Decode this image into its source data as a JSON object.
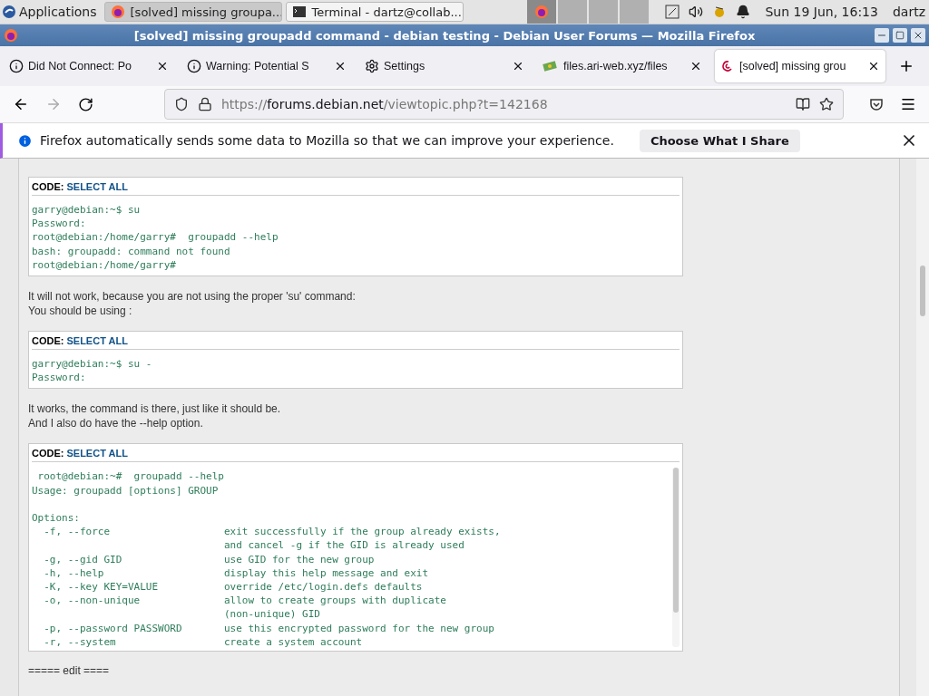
{
  "taskbar": {
    "apps_menu": "Applications",
    "windows": [
      {
        "title": "[solved] missing groupa...",
        "kind": "firefox",
        "selected": true
      },
      {
        "title": "Terminal - dartz@collab...",
        "kind": "terminal",
        "selected": false
      }
    ],
    "workspaces": [
      {
        "selected": true
      },
      {
        "selected": false
      },
      {
        "selected": false
      },
      {
        "selected": false
      }
    ],
    "clock": "Sun 19 Jun, 16:13",
    "user": "dartz"
  },
  "window": {
    "title": "[solved] missing groupadd command - debian testing - Debian User Forums — Mozilla Firefox"
  },
  "tabs": [
    {
      "label": "Did Not Connect: Po",
      "kind": "info",
      "selected": false
    },
    {
      "label": "Warning: Potential S",
      "kind": "info",
      "selected": false
    },
    {
      "label": "Settings",
      "kind": "settings",
      "selected": false
    },
    {
      "label": "files.ari-web.xyz/files",
      "kind": "files",
      "selected": false
    },
    {
      "label": "[solved] missing grou",
      "kind": "debian",
      "selected": true
    }
  ],
  "address_bar": {
    "scheme": "https://",
    "host": "forums.debian.net",
    "path": "/viewtopic.php?t=142168"
  },
  "notification": {
    "message": "Firefox automatically sends some data to Mozilla so that we can improve your experience.",
    "button": "Choose What I Share"
  },
  "post": [
    {
      "kind": "code",
      "label": "CODE:",
      "action": "SELECT ALL",
      "scrollable": false,
      "groups": [
        [
          "garry@debian:~$ su",
          "Password:",
          "root@debian:/home/garry#  groupadd --help",
          "bash: groupadd: command not found",
          "root@debian:/home/garry#"
        ]
      ]
    },
    {
      "kind": "text",
      "lines": [
        "It will not work, because you are not using the proper 'su' command:",
        "You should be using :"
      ]
    },
    {
      "kind": "code",
      "label": "CODE:",
      "action": "SELECT ALL",
      "scrollable": false,
      "groups": [
        [
          "garry@debian:~$ su -",
          "Password:"
        ]
      ]
    },
    {
      "kind": "text",
      "lines": [
        "It works, the command is there, just like it should be.",
        "And I also do have the --help option."
      ]
    },
    {
      "kind": "code",
      "label": "CODE:",
      "action": "SELECT ALL",
      "scrollable": true,
      "groups": [
        [
          " root@debian:~#  groupadd --help",
          "Usage: groupadd [options] GROUP"
        ],
        [
          "Options:",
          "  -f, --force                   exit successfully if the group already exists,",
          "                                and cancel -g if the GID is already used",
          "  -g, --gid GID                 use GID for the new group",
          "  -h, --help                    display this help message and exit",
          "  -K, --key KEY=VALUE           override /etc/login.defs defaults",
          "  -o, --non-unique              allow to create groups with duplicate",
          "                                (non-unique) GID",
          "  -p, --password PASSWORD       use this encrypted password for the new group",
          "  -r, --system                  create a system account"
        ]
      ]
    },
    {
      "kind": "text",
      "lines": [
        "===== edit ===="
      ]
    }
  ]
}
